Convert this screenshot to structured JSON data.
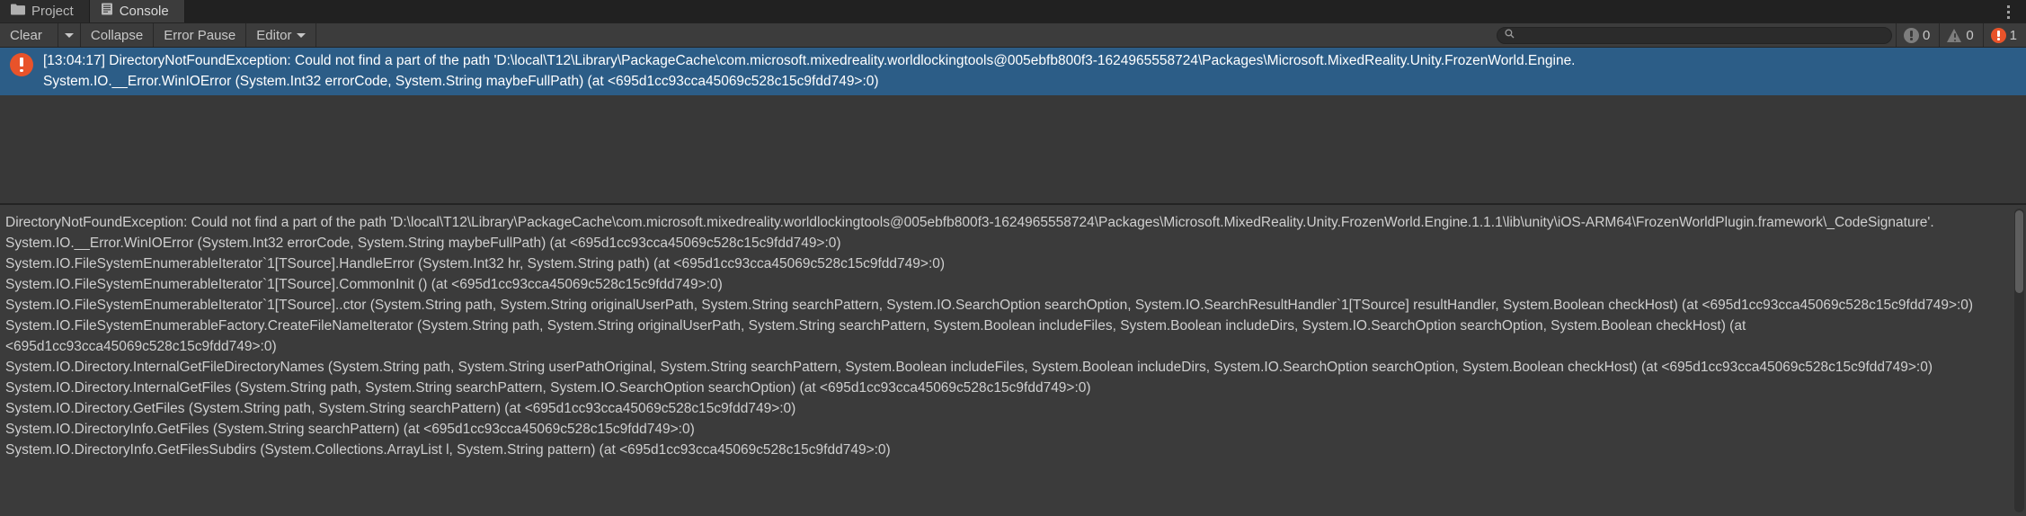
{
  "window": {
    "title": "Console",
    "menu_icon": "more-vertical-icon"
  },
  "tabs": [
    {
      "label": "Project",
      "icon": "folder-icon",
      "active": false
    },
    {
      "label": "Console",
      "icon": "console-icon",
      "active": true
    }
  ],
  "toolbar": {
    "clear_label": "Clear",
    "clear_caret_icon": "chevron-down-icon",
    "collapse_label": "Collapse",
    "error_pause_label": "Error Pause",
    "editor_label": "Editor",
    "editor_caret_icon": "chevron-down-icon",
    "search": {
      "value": "",
      "placeholder": "",
      "icon": "search-icon"
    },
    "counters": {
      "info": {
        "icon": "info-icon",
        "count": "0"
      },
      "warning": {
        "icon": "warning-icon",
        "count": "0"
      },
      "error": {
        "icon": "error-icon",
        "count": "1"
      }
    }
  },
  "log_entries": [
    {
      "severity": "error",
      "icon": "error-icon",
      "selected": true,
      "line1": "[13:04:17] DirectoryNotFoundException: Could not find a part of the path 'D:\\local\\T12\\Library\\PackageCache\\com.microsoft.mixedreality.worldlockingtools@005ebfb800f3-1624965558724\\Packages\\Microsoft.MixedReality.Unity.FrozenWorld.Engine.",
      "line2": "System.IO.__Error.WinIOError (System.Int32 errorCode, System.String maybeFullPath) (at <695d1cc93cca45069c528c15c9fdd749>:0)"
    }
  ],
  "detail": {
    "lines": [
      "DirectoryNotFoundException: Could not find a part of the path 'D:\\local\\T12\\Library\\PackageCache\\com.microsoft.mixedreality.worldlockingtools@005ebfb800f3-1624965558724\\Packages\\Microsoft.MixedReality.Unity.FrozenWorld.Engine.1.1.1\\lib\\unity\\iOS-ARM64\\FrozenWorldPlugin.framework\\_CodeSignature'.",
      "System.IO.__Error.WinIOError (System.Int32 errorCode, System.String maybeFullPath) (at <695d1cc93cca45069c528c15c9fdd749>:0)",
      "System.IO.FileSystemEnumerableIterator`1[TSource].HandleError (System.Int32 hr, System.String path) (at <695d1cc93cca45069c528c15c9fdd749>:0)",
      "System.IO.FileSystemEnumerableIterator`1[TSource].CommonInit () (at <695d1cc93cca45069c528c15c9fdd749>:0)",
      "System.IO.FileSystemEnumerableIterator`1[TSource]..ctor (System.String path, System.String originalUserPath, System.String searchPattern, System.IO.SearchOption searchOption, System.IO.SearchResultHandler`1[TSource] resultHandler, System.Boolean checkHost) (at <695d1cc93cca45069c528c15c9fdd749>:0)",
      "System.IO.FileSystemEnumerableFactory.CreateFileNameIterator (System.String path, System.String originalUserPath, System.String searchPattern, System.Boolean includeFiles, System.Boolean includeDirs, System.IO.SearchOption searchOption, System.Boolean checkHost) (at <695d1cc93cca45069c528c15c9fdd749>:0)",
      "System.IO.Directory.InternalGetFileDirectoryNames (System.String path, System.String userPathOriginal, System.String searchPattern, System.Boolean includeFiles, System.Boolean includeDirs, System.IO.SearchOption searchOption, System.Boolean checkHost) (at <695d1cc93cca45069c528c15c9fdd749>:0)",
      "System.IO.Directory.InternalGetFiles (System.String path, System.String searchPattern, System.IO.SearchOption searchOption) (at <695d1cc93cca45069c528c15c9fdd749>:0)",
      "System.IO.Directory.GetFiles (System.String path, System.String searchPattern) (at <695d1cc93cca45069c528c15c9fdd749>:0)",
      "System.IO.DirectoryInfo.GetFiles (System.String searchPattern) (at <695d1cc93cca45069c528c15c9fdd749>:0)",
      "System.IO.DirectoryInfo.GetFilesSubdirs (System.Collections.ArrayList l, System.String pattern) (at <695d1cc93cca45069c528c15c9fdd749>:0)"
    ]
  },
  "colors": {
    "selection": "#2c5d87",
    "error": "#e8532a",
    "panel": "#383838",
    "toolbar": "#3c3c3c",
    "tabstrip": "#212121"
  }
}
